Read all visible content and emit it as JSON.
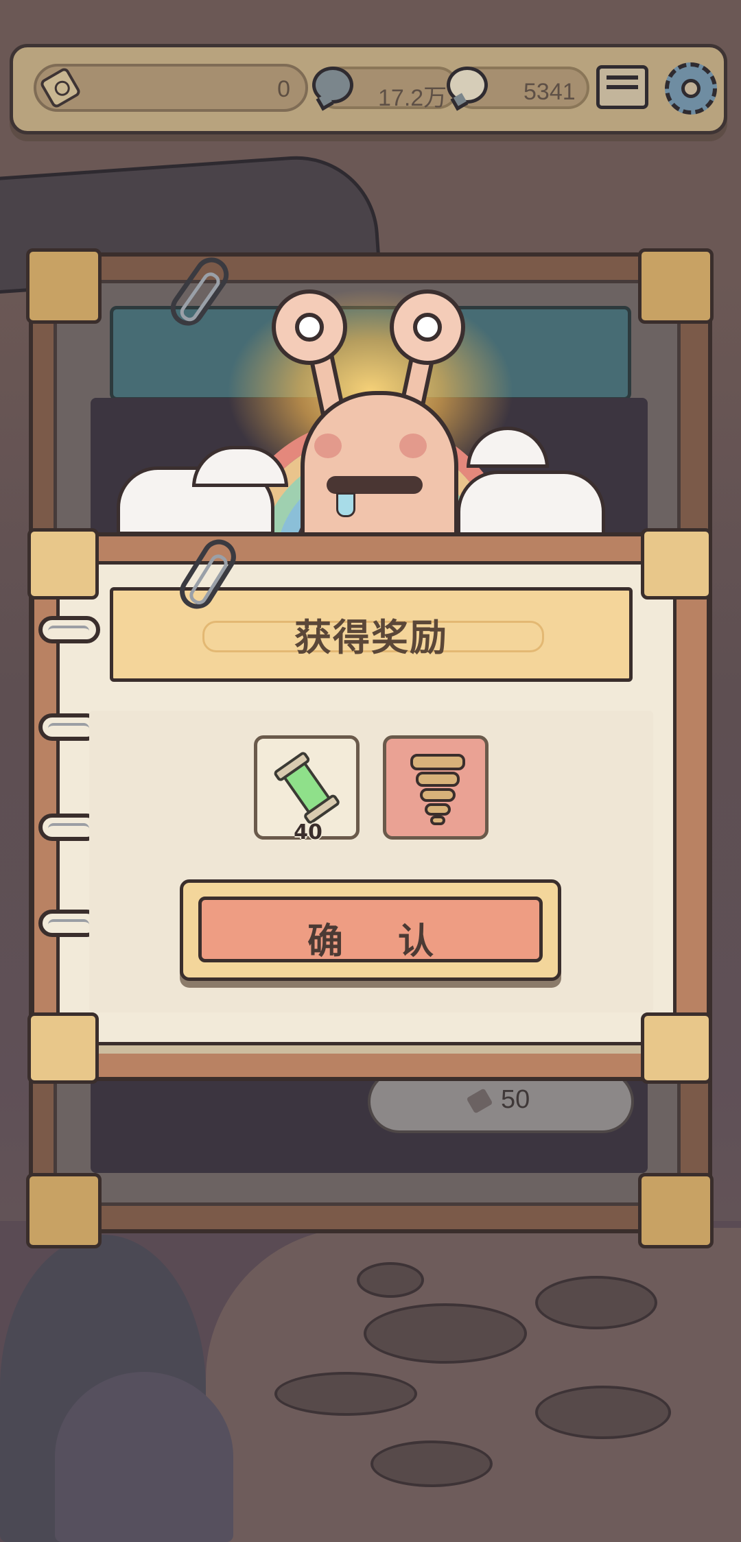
{
  "topbar": {
    "ticket_value": "0",
    "currency_a_value": "17.2万",
    "currency_b_value": "5341",
    "icons": {
      "ticket": "ticket-icon",
      "currency_a": "speech-bubble-icon",
      "currency_b": "speech-bubble-icon",
      "mail": "mail-icon",
      "settings": "gear-icon"
    }
  },
  "background_panel": {
    "cost_value": "50"
  },
  "dialog": {
    "title": "获得奖励",
    "rewards": [
      {
        "icon": "scroll-tube-icon",
        "count": "40"
      },
      {
        "icon": "fossil-icon",
        "count": ""
      }
    ],
    "confirm_label": "确认"
  },
  "colors": {
    "accent_orange": "#ee9d83",
    "banner_yellow": "#f4d59a",
    "paper": "#f2ead9",
    "frame_brown": "#b98263"
  }
}
